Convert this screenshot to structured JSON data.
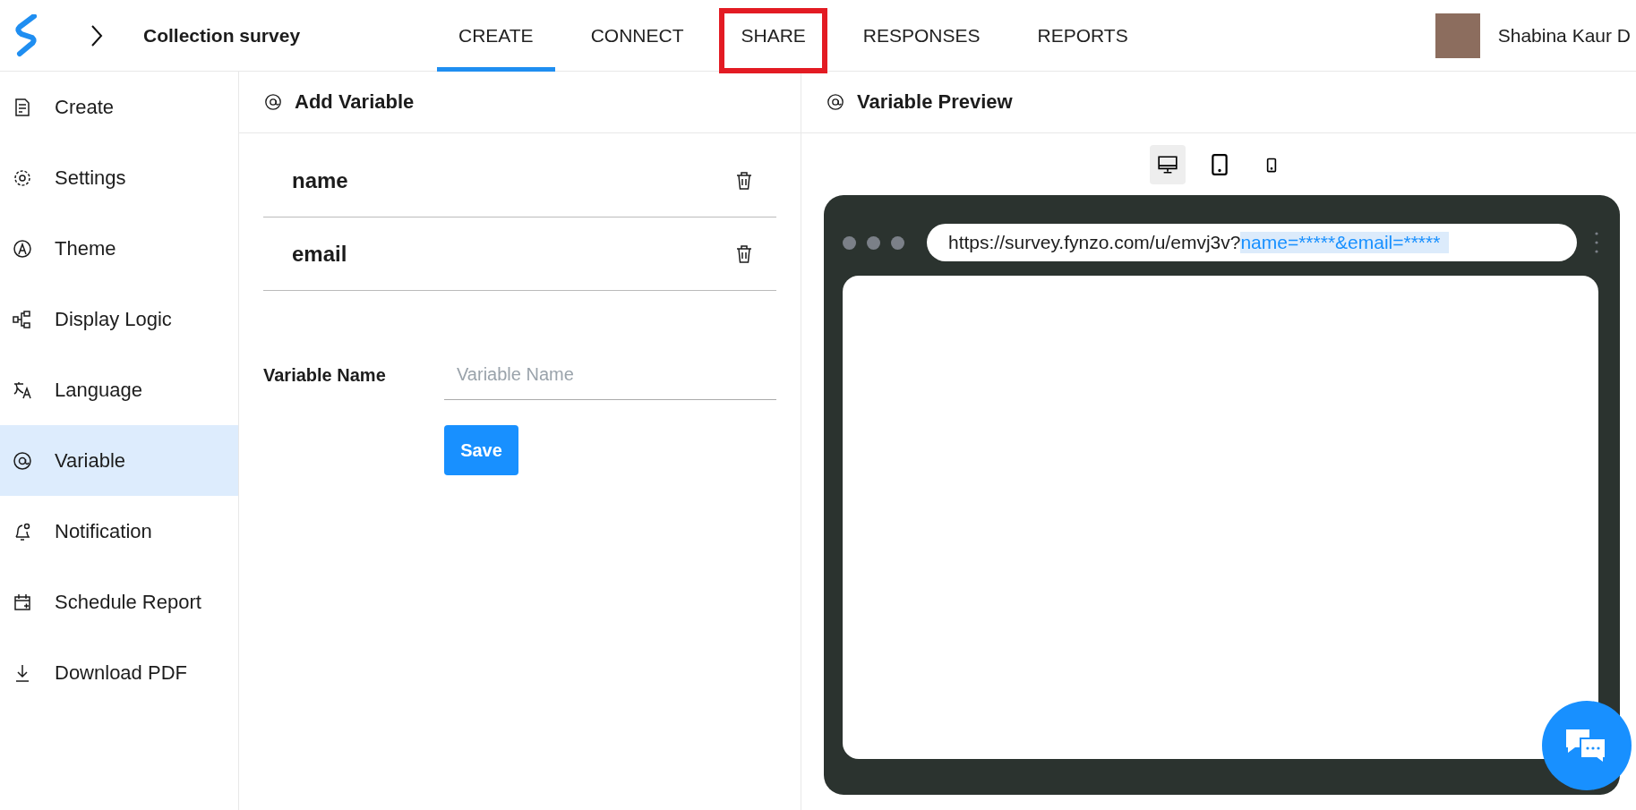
{
  "header": {
    "survey_title": "Collection survey",
    "user_name": "Shabina Kaur D"
  },
  "tabs": [
    {
      "label": "CREATE",
      "selected": true,
      "highlighted": false
    },
    {
      "label": "CONNECT",
      "selected": false,
      "highlighted": false
    },
    {
      "label": "SHARE",
      "selected": false,
      "highlighted": true
    },
    {
      "label": "RESPONSES",
      "selected": false,
      "highlighted": false
    },
    {
      "label": "REPORTS",
      "selected": false,
      "highlighted": false
    }
  ],
  "sidebar": {
    "items": [
      {
        "label": "Create",
        "kind": "document",
        "selected": false
      },
      {
        "label": "Settings",
        "kind": "gear",
        "selected": false
      },
      {
        "label": "Theme",
        "kind": "theme",
        "selected": false
      },
      {
        "label": "Display Logic",
        "kind": "logic",
        "selected": false
      },
      {
        "label": "Language",
        "kind": "language",
        "selected": false
      },
      {
        "label": "Variable",
        "kind": "at",
        "selected": true
      },
      {
        "label": "Notification",
        "kind": "bell",
        "selected": false
      },
      {
        "label": "Schedule Report",
        "kind": "calendar",
        "selected": false
      },
      {
        "label": "Download PDF",
        "kind": "download",
        "selected": false
      }
    ]
  },
  "add_variable": {
    "title": "Add Variable",
    "variables": [
      "name",
      "email"
    ],
    "field_label": "Variable Name",
    "placeholder": "Variable Name",
    "save_button": "Save"
  },
  "preview": {
    "title": "Variable Preview",
    "devices": [
      {
        "kind": "desktop",
        "selected": true
      },
      {
        "kind": "tablet",
        "selected": false
      },
      {
        "kind": "phone",
        "selected": false
      }
    ],
    "url_base": "https://survey.fynzo.com/u/emvj3v?",
    "url_params": "name=*****&email=*****"
  }
}
